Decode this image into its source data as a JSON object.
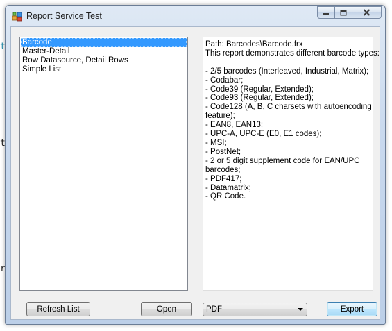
{
  "background": {
    "fragments": [
      "t",
      "t",
      "r"
    ]
  },
  "window": {
    "title": "Report Service Test",
    "icon": "report-app-icon",
    "caption_buttons": [
      "minimize-icon",
      "maximize-icon",
      "close-icon"
    ]
  },
  "report_list": {
    "items": [
      {
        "label": "Barcode",
        "selected": true
      },
      {
        "label": "Master-Detail",
        "selected": false
      },
      {
        "label": "Row Datasource, Detail Rows",
        "selected": false
      },
      {
        "label": "Simple List",
        "selected": false
      }
    ]
  },
  "description": {
    "lines": [
      "Path: Barcodes\\Barcode.frx",
      "This report demonstrates different barcode types:",
      "",
      "- 2/5 barcodes (Interleaved, Industrial, Matrix);",
      "- Codabar;",
      "- Code39 (Regular, Extended);",
      "- Code93 (Regular, Extended);",
      "- Code128 (A, B, C charsets with autoencoding",
      "feature);",
      "- EAN8, EAN13;",
      "- UPC-A, UPC-E (E0, E1 codes);",
      "- MSI;",
      "- PostNet;",
      "- 2 or 5 digit supplement code for EAN/UPC",
      "barcodes;",
      "- PDF417;",
      "- Datamatrix;",
      "- QR Code."
    ]
  },
  "buttons": {
    "refresh_label": "Refresh List",
    "open_label": "Open",
    "export_label": "Export"
  },
  "export_format": {
    "selected": "PDF"
  },
  "colors": {
    "selection": "#3399ff",
    "client_bg": "#f0f0f0",
    "frame": "#bccfe8"
  }
}
